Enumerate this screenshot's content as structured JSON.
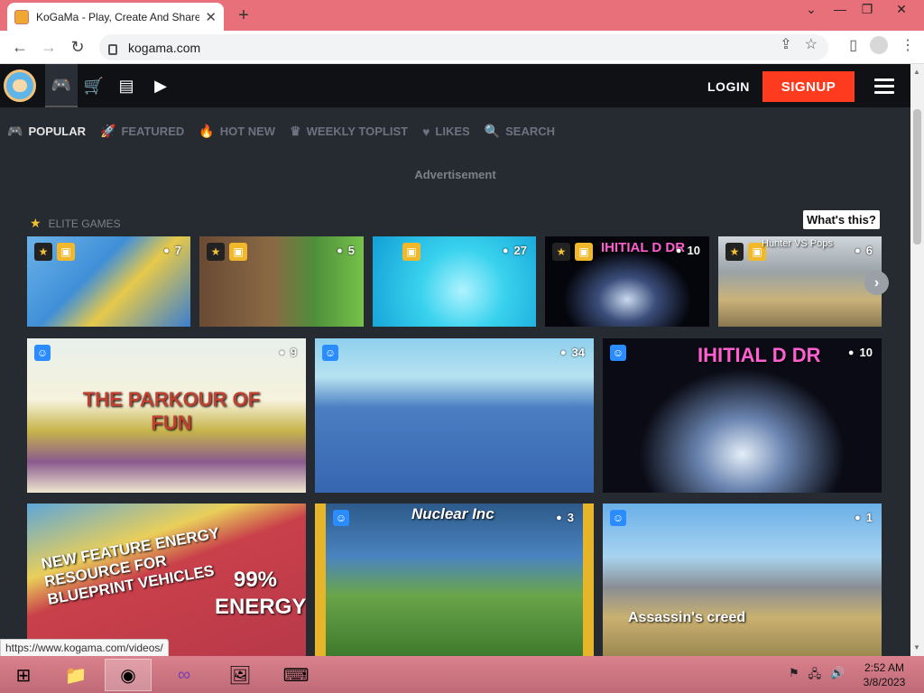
{
  "browser": {
    "tab_title": "KoGaMa - Play, Create And Share",
    "tab_close": "✕",
    "new_tab": "+",
    "url": "kogama.com",
    "status_url": "https://www.kogama.com/videos/"
  },
  "window_controls": {
    "chevron": "⌄",
    "restore": "❐",
    "close": "✕"
  },
  "topnav": {
    "login_label": "LOGIN",
    "signup_label": "SIGNUP"
  },
  "subnav": [
    {
      "label": "POPULAR",
      "icon": "gamepad-icon"
    },
    {
      "label": "FEATURED",
      "icon": "rocket-icon"
    },
    {
      "label": "HOT NEW",
      "icon": "fire-icon"
    },
    {
      "label": "WEEKLY TOPLIST",
      "icon": "crown-icon"
    },
    {
      "label": "LIKES",
      "icon": "heart-icon"
    },
    {
      "label": "SEARCH",
      "icon": "search-icon"
    }
  ],
  "advertisement_label": "Advertisement",
  "elite_label": "ELITE GAMES",
  "whats_this_label": "What's this?",
  "elite_games": [
    {
      "players": "7",
      "caption": ""
    },
    {
      "players": "5",
      "caption": ""
    },
    {
      "players": "27",
      "caption": ""
    },
    {
      "players": "10",
      "caption": "IHITIAL D DR"
    },
    {
      "players": "6",
      "caption": "Hunter VS Pops"
    }
  ],
  "games_row1": [
    {
      "players": "9",
      "caption": "THE PARKOUR OF FUN"
    },
    {
      "players": "34",
      "caption": ""
    },
    {
      "players": "10",
      "caption": "IHITIAL D DR"
    }
  ],
  "games_row2": [
    {
      "players": "",
      "caption": "NEW FEATURE ENERGY RESOURCE FOR BLUEPRINT VEHICLES",
      "energy": "99% ENERGY"
    },
    {
      "players": "3",
      "caption": "Nuclear Inc"
    },
    {
      "players": "1",
      "caption": "Assassin's creed"
    }
  ],
  "taskbar": {
    "time": "2:52 AM",
    "date": "3/8/2023"
  }
}
